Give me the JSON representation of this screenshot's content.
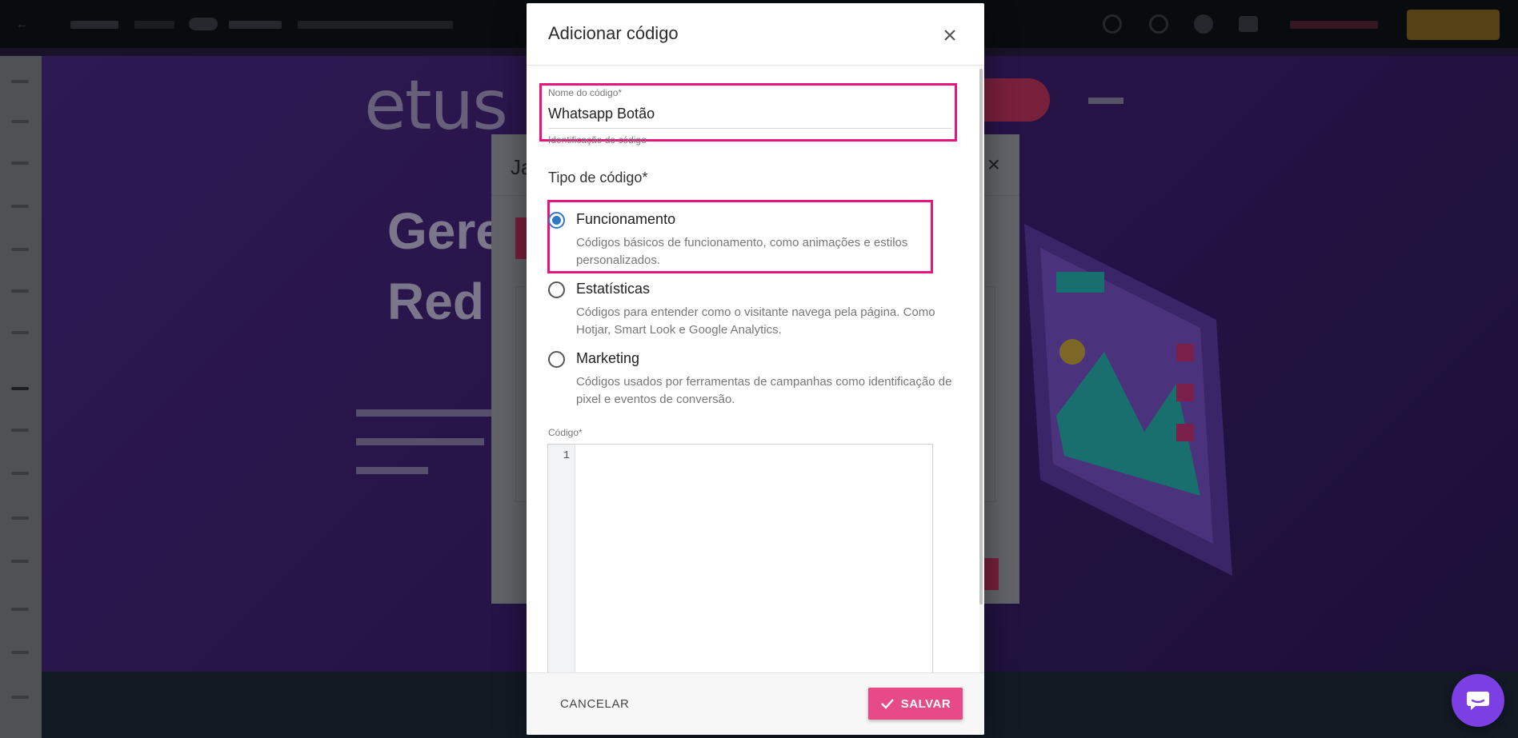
{
  "modal": {
    "title": "Adicionar código",
    "name_field": {
      "label": "Nome do código*",
      "value": "Whatsapp Botão",
      "helper": "Identificação do código"
    },
    "type_section_title": "Tipo de código*",
    "type_options": [
      {
        "label": "Funcionamento",
        "description": "Códigos básicos de funcionamento, como animações e estilos personalizados.",
        "selected": true
      },
      {
        "label": "Estatísticas",
        "description": "Códigos para entender como o visitante navega pela página. Como Hotjar, Smart Look e Google Analytics.",
        "selected": false
      },
      {
        "label": "Marketing",
        "description": "Códigos usados por ferramentas de campanhas como identificação de pixel e eventos de conversão.",
        "selected": false
      }
    ],
    "code_field": {
      "label": "Código*",
      "line_numbers": [
        "1"
      ],
      "value": ""
    },
    "cancel_label": "CANCELAR",
    "save_label": "SALVAR"
  },
  "background": {
    "logo_text": "etus",
    "heading_lines": [
      "Gere",
      "Red"
    ],
    "underlying_dialog_title": "Ja"
  },
  "colors": {
    "highlight": "#e6157e",
    "save_button": "#e64a87",
    "radio_selected": "#2f78c4",
    "chat_button": "#7b3fe4",
    "canvas_purple": "#4a2a86"
  },
  "icons": {
    "close": "close-icon",
    "save": "check-icon",
    "chat": "chat-bubble-icon"
  }
}
